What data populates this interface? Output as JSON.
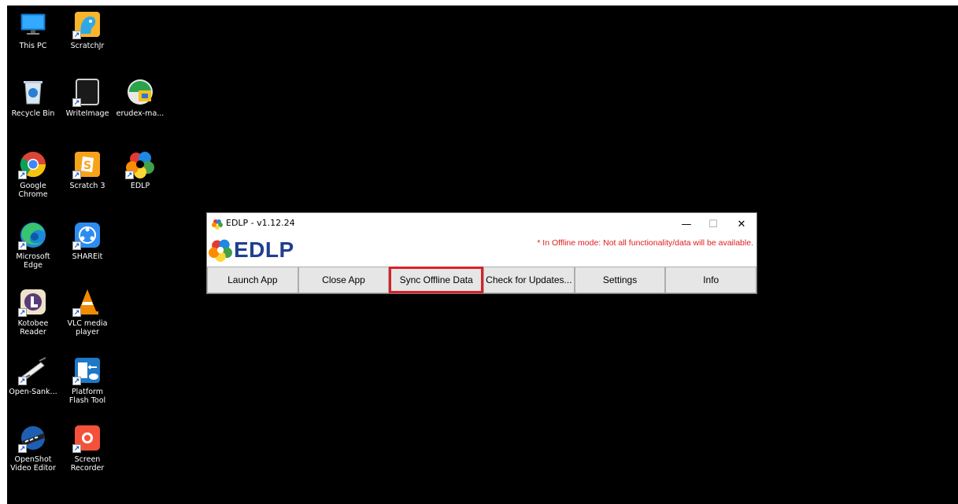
{
  "desktop": {
    "icons": [
      {
        "label": "This PC",
        "icon": "computer-monitor-icon"
      },
      {
        "label": "ScratchJr",
        "icon": "scratchjr-icon"
      },
      {
        "label": "Recycle Bin",
        "icon": "recycle-bin-icon"
      },
      {
        "label": "WriteImage",
        "icon": "writeimage-icon"
      },
      {
        "label": "erudex-ma...",
        "icon": "erudex-icon"
      },
      {
        "label": "Google Chrome",
        "icon": "chrome-icon"
      },
      {
        "label": "Scratch 3",
        "icon": "scratch3-icon"
      },
      {
        "label": "EDLP",
        "icon": "edlp-icon"
      },
      {
        "label": "Microsoft Edge",
        "icon": "edge-icon"
      },
      {
        "label": "SHAREit",
        "icon": "shareit-icon"
      },
      {
        "label": "Kotobee Reader",
        "icon": "kotobee-icon"
      },
      {
        "label": "VLC media player",
        "icon": "vlc-icon"
      },
      {
        "label": "Open-Sank...",
        "icon": "opensankore-icon"
      },
      {
        "label": "Platform Flash Tool",
        "icon": "platform-flash-tool-icon"
      },
      {
        "label": "OpenShot Video Editor",
        "icon": "openshot-icon"
      },
      {
        "label": "Screen Recorder",
        "icon": "screen-recorder-icon"
      }
    ]
  },
  "window": {
    "title": "EDLP - v1.12.24",
    "logo_text": "EDLP",
    "offline_note": "* In Offline mode: Not all functionality/data will be available.",
    "controls": {
      "minimize": "—",
      "maximize": "☐",
      "close": "✕"
    },
    "buttons": [
      "Launch App",
      "Close App",
      "Sync Offline Data",
      "Check for Updates...",
      "Settings",
      "Info"
    ],
    "highlighted_button": "Sync Offline Data",
    "highlight_color": "#d92027",
    "note_color": "#e01b1b"
  }
}
